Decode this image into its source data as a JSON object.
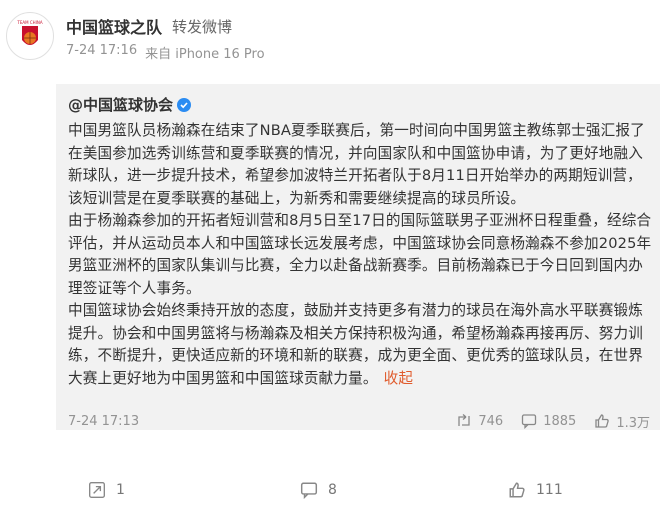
{
  "post": {
    "author": "中国篮球之队",
    "repost_label": "转发微博",
    "time": "7-24 17:16",
    "source": "来自 iPhone 16 Pro",
    "avatar_text": "TEAM CHINA"
  },
  "original": {
    "author": "@中国篮球协会",
    "paragraphs": [
      "中国男篮队员杨瀚森在结束了NBA夏季联赛后，第一时间向中国男篮主教练郭士强汇报了在美国参加选秀训练营和夏季联赛的情况，并向国家队和中国篮协申请，为了更好地融入新球队，进一步提升技术，希望参加波特兰开拓者队于8月11日开始举办的两期短训营，该短训营是在夏季联赛的基础上，为新秀和需要继续提高的球员所设。",
      "由于杨瀚森参加的开拓者短训营和8月5日至17日的国际篮联男子亚洲杯日程重叠，经综合评估，并从运动员本人和中国篮球长远发展考虑，中国篮球协会同意杨瀚森不参加2025年男篮亚洲杯的国家队集训与比赛，全力以赴备战新赛季。目前杨瀚森已于今日回到国内办理签证等个人事务。",
      "中国篮球协会始终秉持开放的态度，鼓励并支持更多有潜力的球员在海外高水平联赛锻炼提升。协会和中国男篮将与杨瀚森及相关方保持积极沟通，希望杨瀚森再接再厉、努力训练，不断提升，更快适应新的环境和新的联赛，成为更全面、更优秀的篮球队员，在世界大赛上更好地为中国男篮和中国篮球贡献力量。"
    ],
    "expand_label": "收起",
    "time": "7-24 17:13",
    "reposts": "746",
    "comments": "1885",
    "likes": "1.3万"
  },
  "actions": {
    "reposts": "1",
    "comments": "8",
    "likes": "111"
  },
  "colors": {
    "accent": "#e05c2e",
    "verified": "#2b8cf2",
    "quoted_bg": "#f2f2f2"
  }
}
